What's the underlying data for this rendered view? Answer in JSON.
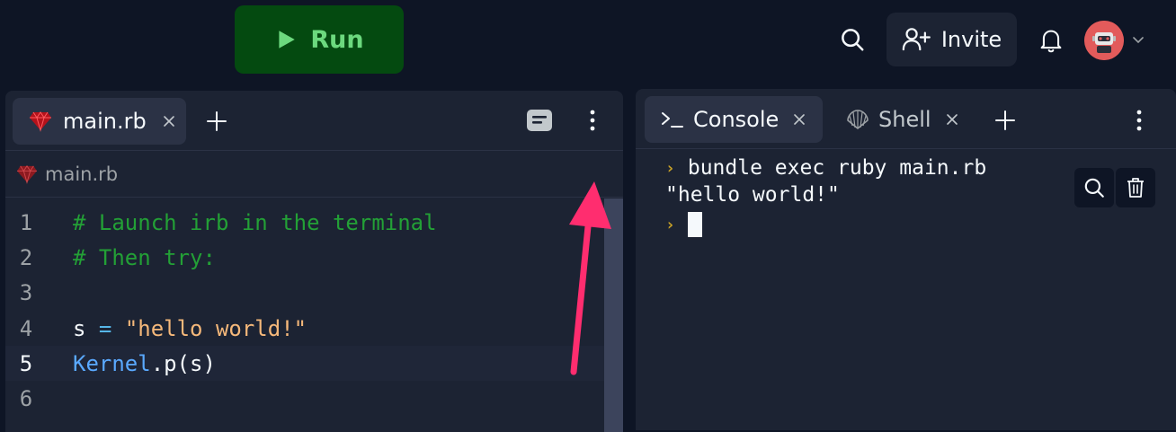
{
  "toolbar": {
    "run_label": "Run",
    "invite_label": "Invite"
  },
  "editor_panel": {
    "tab": {
      "label": "main.rb",
      "icon": "ruby-icon"
    },
    "breadcrumb": {
      "label": "main.rb",
      "icon": "ruby-icon"
    },
    "lines": [
      {
        "number": "1",
        "text": "# Launch irb in the terminal"
      },
      {
        "number": "2",
        "text": "# Then try:"
      },
      {
        "number": "3",
        "text": ""
      },
      {
        "number": "4",
        "parts": [
          "s",
          " = ",
          "\"hello world!\""
        ]
      },
      {
        "number": "5",
        "parts": [
          "Kernel",
          ".p(s)"
        ],
        "active": true
      },
      {
        "number": "6",
        "text": ""
      }
    ]
  },
  "console_panel": {
    "tabs": [
      {
        "label": "Console",
        "icon": "terminal-icon",
        "active": true
      },
      {
        "label": "Shell",
        "icon": "shell-icon",
        "active": false
      }
    ],
    "output": [
      {
        "prompt": true,
        "text": "bundle exec ruby main.rb"
      },
      {
        "prompt": false,
        "text": "\"hello world!\""
      }
    ]
  },
  "colors": {
    "background": "#0e1525",
    "panel": "#1c2333",
    "run_button": "#044a10",
    "run_text": "#6cd97e",
    "annotation_arrow": "#ff2d6f"
  }
}
